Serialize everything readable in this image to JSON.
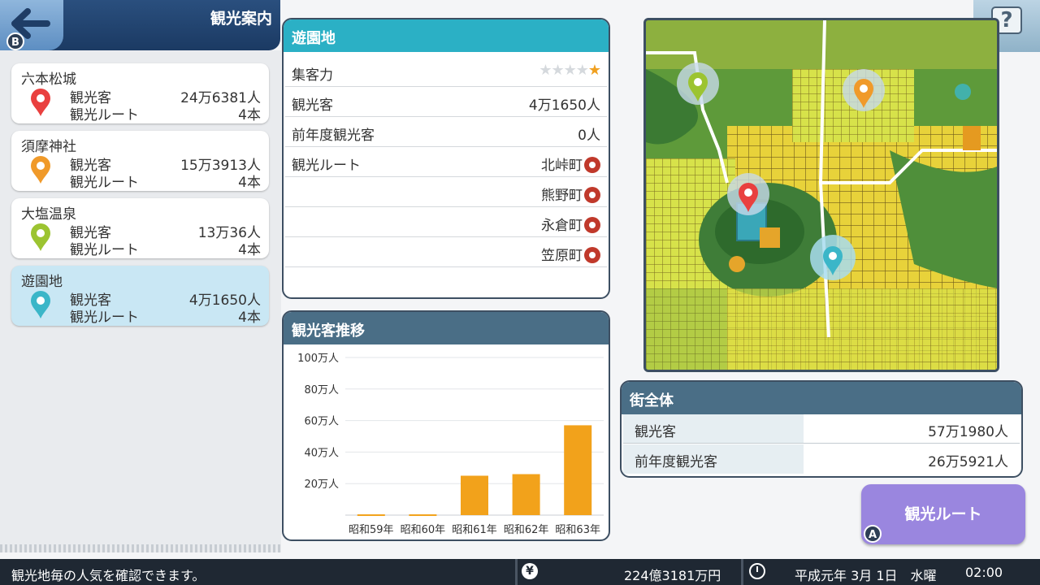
{
  "header": {
    "title": "観光案内",
    "back_badge": "B"
  },
  "help": {
    "icon": "?",
    "plus": "+"
  },
  "sidebar": {
    "items": [
      {
        "name": "六本松城",
        "visitors_label": "観光客",
        "visitors": "24万6381人",
        "routes_label": "観光ルート",
        "routes": "4本",
        "color": "#e9403f"
      },
      {
        "name": "須摩神社",
        "visitors_label": "観光客",
        "visitors": "15万3913人",
        "routes_label": "観光ルート",
        "routes": "4本",
        "color": "#f09a2a"
      },
      {
        "name": "大塩温泉",
        "visitors_label": "観光客",
        "visitors": "13万36人",
        "routes_label": "観光ルート",
        "routes": "4本",
        "color": "#9cc431"
      },
      {
        "name": "遊園地",
        "visitors_label": "観光客",
        "visitors": "4万1650人",
        "routes_label": "観光ルート",
        "routes": "4本",
        "color": "#3bb6c8"
      }
    ]
  },
  "detail": {
    "title": "遊園地",
    "attraction_label": "集客力",
    "attraction_stars": 1,
    "visitors_label": "観光客",
    "visitors": "4万1650人",
    "last_year_label": "前年度観光客",
    "last_year": "0人",
    "routes_label": "観光ルート",
    "routes": [
      "北峠町",
      "熊野町",
      "永倉町",
      "笠原町"
    ]
  },
  "chart_panel": {
    "title": "観光客推移"
  },
  "chart_data": {
    "type": "bar",
    "categories": [
      "昭和59年",
      "昭和60年",
      "昭和61年",
      "昭和62年",
      "昭和63年"
    ],
    "values": [
      0.5,
      0.5,
      25,
      26,
      57
    ],
    "y_ticks": [
      "100万人",
      "80万人",
      "60万人",
      "40万人",
      "20万人"
    ],
    "y_tick_values": [
      100,
      80,
      60,
      40,
      20
    ],
    "ylim": [
      0,
      100
    ],
    "unit": "万人",
    "color": "#f2a21b"
  },
  "city": {
    "title": "街全体",
    "visitors_label": "観光客",
    "visitors": "57万1980人",
    "last_year_label": "前年度観光客",
    "last_year": "26万5921人"
  },
  "route_button": {
    "label": "観光ルート",
    "badge": "A"
  },
  "status": {
    "message": "観光地毎の人気を確認できます。",
    "money_icon": "¥",
    "money": "224億3181万円",
    "date": "平成元年 3月 1日　水曜",
    "time": "02:00"
  }
}
